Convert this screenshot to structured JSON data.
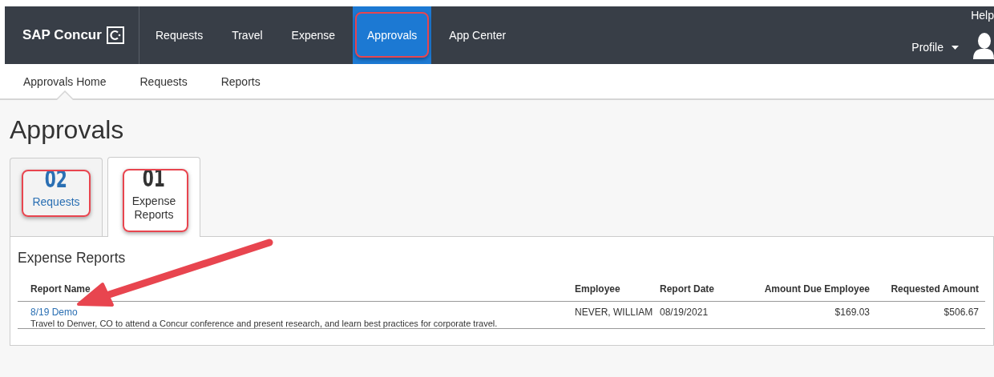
{
  "header": {
    "brand": "SAP Concur",
    "nav_items": [
      {
        "label": "Requests",
        "selected": false
      },
      {
        "label": "Travel",
        "selected": false
      },
      {
        "label": "Expense",
        "selected": false
      },
      {
        "label": "Approvals",
        "selected": true
      },
      {
        "label": "App Center",
        "selected": false
      }
    ],
    "help": "Help",
    "profile": "Profile"
  },
  "subnav": [
    {
      "label": "Approvals Home",
      "selected": true
    },
    {
      "label": "Requests",
      "selected": false
    },
    {
      "label": "Reports",
      "selected": false
    }
  ],
  "page_title": "Approvals",
  "tabs": [
    {
      "count": "02",
      "label": "Requests",
      "selected": false
    },
    {
      "count": "01",
      "label": "Expense Reports",
      "selected": true
    }
  ],
  "section_title": "Expense Reports",
  "table": {
    "columns": [
      "Report Name",
      "Employee",
      "Report Date",
      "Amount Due Employee",
      "Requested Amount"
    ],
    "rows": [
      {
        "report_name": "8/19 Demo",
        "description": "Travel to Denver, CO to attend a Concur conference and present research, and learn best practices for corporate travel.",
        "employee": "NEVER, WILLIAM",
        "report_date": "08/19/2021",
        "amount_due": "$169.03",
        "requested": "$506.67"
      }
    ]
  }
}
